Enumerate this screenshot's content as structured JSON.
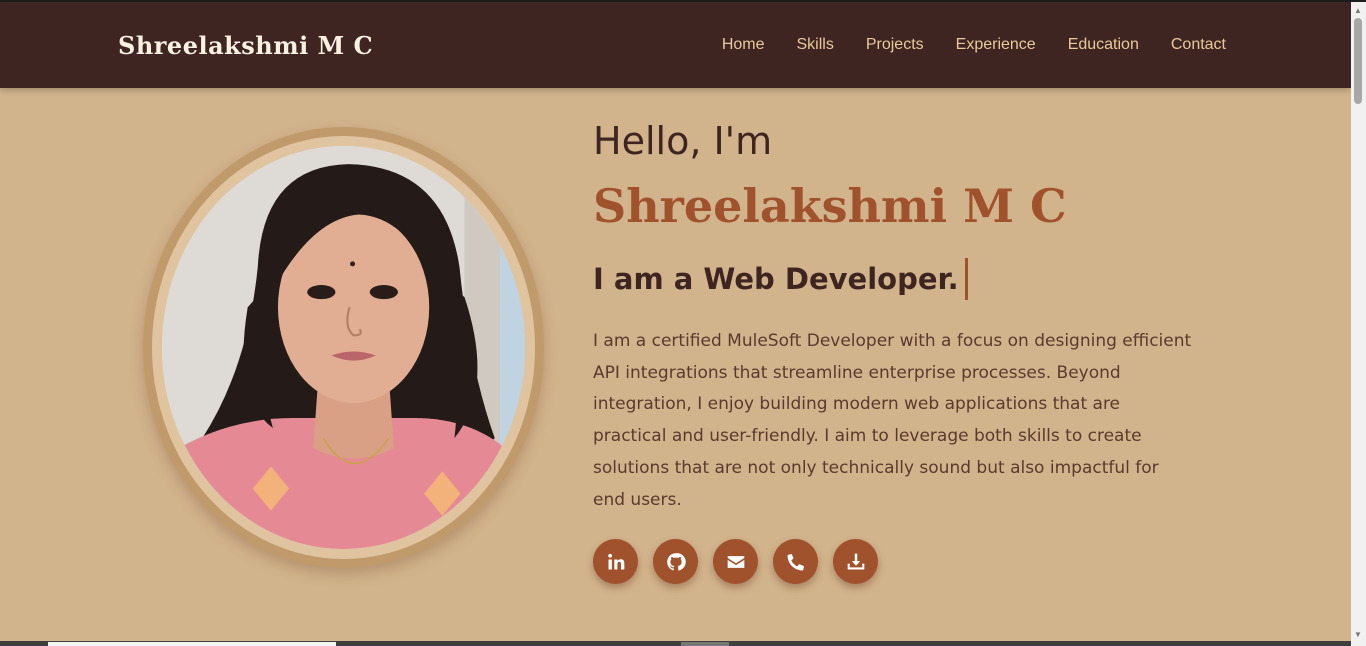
{
  "brand": "Shreelakshmi M C",
  "nav": {
    "items": [
      {
        "label": "Home"
      },
      {
        "label": "Skills"
      },
      {
        "label": "Projects"
      },
      {
        "label": "Experience"
      },
      {
        "label": "Education"
      },
      {
        "label": "Contact"
      }
    ]
  },
  "hero": {
    "greeting": "Hello, I'm",
    "name": "Shreelakshmi M C",
    "tagline": "I am a Web Developer.",
    "bio": "I am a certified MuleSoft Developer with a focus on designing efficient API integrations that streamline enterprise processes. Beyond integration, I enjoy building modern web applications that are practical and user-friendly. I aim to leverage both skills to create solutions that are not only technically sound but also impactful for end users.",
    "socials": [
      {
        "icon": "linkedin-icon"
      },
      {
        "icon": "github-icon"
      },
      {
        "icon": "envelope-icon"
      },
      {
        "icon": "phone-icon"
      },
      {
        "icon": "download-icon"
      }
    ]
  },
  "colors": {
    "navbar": "#3e2521",
    "background": "#d2b48c",
    "accent": "#a0522d",
    "text_dark": "#3e2521"
  }
}
